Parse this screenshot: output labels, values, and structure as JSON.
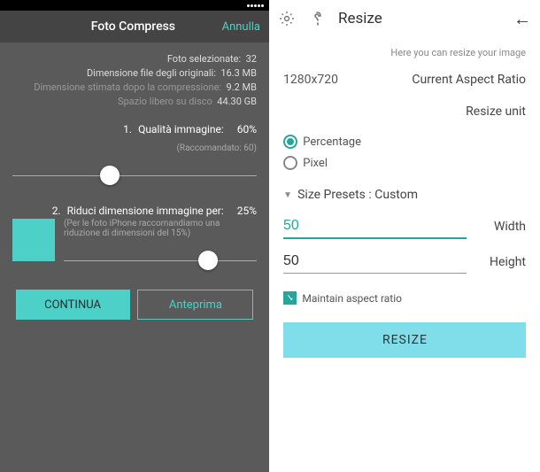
{
  "left": {
    "navbar": {
      "cancel": "Annulla",
      "title": "Foto Compress"
    },
    "info": {
      "selected_label": "Foto selezionate:",
      "selected_value": "32",
      "orig_size_label": "Dimensione file degli originali:",
      "orig_size_value": "16.3 MB",
      "est_label": "Dimensione stimata dopo la compressione:",
      "est_value": "9.2 MB",
      "free_label": "Spazio libero su disco",
      "free_value": "44.30 GB"
    },
    "quality": {
      "num": "1.",
      "label": "Qualità immagine:",
      "value": "60%",
      "sub": "(Raccomandato: 60)",
      "pos": 60
    },
    "size": {
      "num": "2.",
      "label": "Riduci dimensione immagine per:",
      "value": "25%",
      "sub": "(Per le foto iPhone raccomandiamo una riduzione di dimensioni del 15%)",
      "pos": 25
    },
    "buttons": {
      "preview": "Anteprima",
      "continue": "CONTINUA"
    }
  },
  "right": {
    "title": "Resize",
    "hint": "Here you can resize your image",
    "aspect": {
      "label": "Current Aspect Ratio",
      "value": "1280x720"
    },
    "unit": {
      "label": "Resize unit"
    },
    "radios": {
      "percentage": "Percentage",
      "pixel": "Pixel"
    },
    "preset": {
      "label": "Size Presets :",
      "value": "Custom"
    },
    "width": {
      "label": "Width",
      "value": "50"
    },
    "height": {
      "label": "Height",
      "value": "50"
    },
    "maintain": "Maintain aspect ratio",
    "resize_btn": "RESIZE"
  }
}
